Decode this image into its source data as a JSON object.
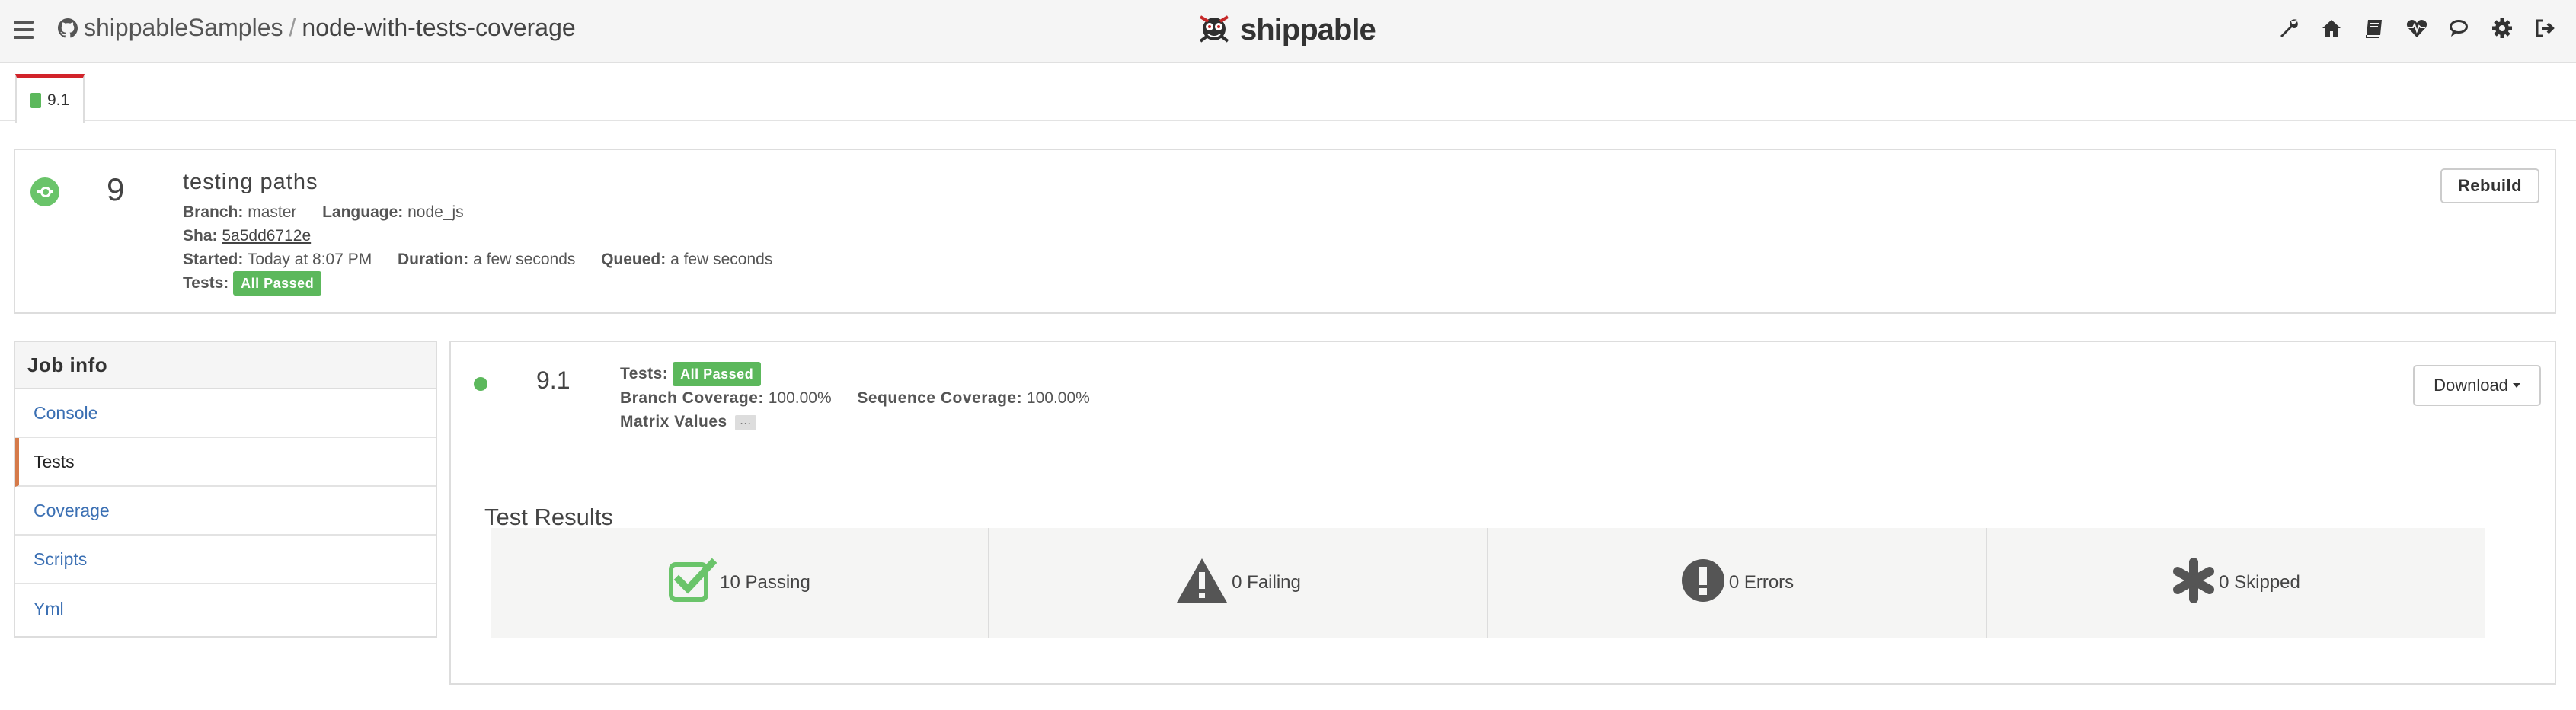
{
  "header": {
    "org": "shippableSamples",
    "separator": "/",
    "repo": "node-with-tests-coverage",
    "brand": "shippable",
    "nav_icons": [
      "wrench-icon",
      "home-icon",
      "book-icon",
      "heartbeat-icon",
      "comments-icon",
      "gear-icon",
      "sign-out-icon"
    ]
  },
  "tabs": [
    {
      "label": "9.1",
      "active": true
    }
  ],
  "build": {
    "number": "9",
    "title": "testing paths",
    "branch_label": "Branch:",
    "branch": "master",
    "language_label": "Language:",
    "language": "node_js",
    "sha_label": "Sha:",
    "sha": "5a5dd6712e",
    "started_label": "Started:",
    "started": "Today at 8:07 PM",
    "duration_label": "Duration:",
    "duration": "a few seconds",
    "queued_label": "Queued:",
    "queued": "a few seconds",
    "tests_label": "Tests:",
    "tests_status": "All Passed",
    "rebuild_label": "Rebuild"
  },
  "sidebar": {
    "title": "Job info",
    "items": [
      {
        "label": "Console",
        "active": false
      },
      {
        "label": "Tests",
        "active": true
      },
      {
        "label": "Coverage",
        "active": false
      },
      {
        "label": "Scripts",
        "active": false
      },
      {
        "label": "Yml",
        "active": false
      }
    ]
  },
  "job": {
    "number": "9.1",
    "tests_label": "Tests:",
    "tests_status": "All Passed",
    "branch_coverage_label": "Branch Coverage:",
    "branch_coverage": "100.00%",
    "sequence_coverage_label": "Sequence Coverage:",
    "sequence_coverage": "100.00%",
    "matrix_label": "Matrix Values",
    "matrix_toggle": "…",
    "download_label": "Download"
  },
  "results": {
    "title": "Test Results",
    "passing": "10 Passing",
    "failing": "0 Failing",
    "errors": "0 Errors",
    "skipped": "0 Skipped"
  },
  "colors": {
    "success": "#5cb85c",
    "link": "#3a6fb3",
    "tab_accent": "#d2232a",
    "active_item_accent": "#d57a4a"
  }
}
